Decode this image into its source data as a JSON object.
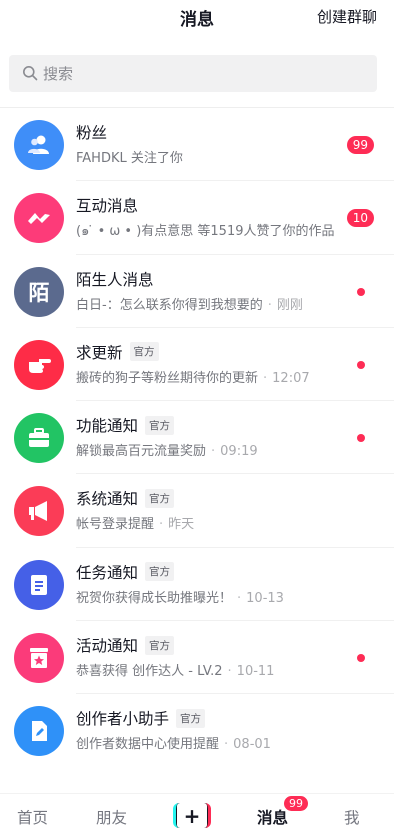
{
  "header": {
    "title": "消息",
    "action_label": "创建群聊"
  },
  "search": {
    "placeholder": "搜索"
  },
  "messages": [
    {
      "title": "粉丝",
      "subtitle": "FAHDKL 关注了你",
      "badge": "99",
      "avatar_color": "#3f8ef8",
      "icon": "users-icon"
    },
    {
      "title": "互动消息",
      "subtitle": "(๑ ̇ • ω • )有点意思 等1519人赞了你的作品",
      "badge": "10",
      "avatar_color": "#fd3b79",
      "icon": "wave-icon"
    },
    {
      "title": "陌生人消息",
      "subtitle": "白日-：怎么联系你得到我想要的",
      "time": "刚刚",
      "dot": true,
      "avatar_color": "#5b6a8e",
      "avatar_char": "陌"
    },
    {
      "title": "求更新",
      "tag": "官方",
      "subtitle": "搬砖的狗子等粉丝期待你的更新",
      "time": "12:07",
      "dot": true,
      "avatar_color": "#fe2c47",
      "icon": "pointing-hand-icon"
    },
    {
      "title": "功能通知",
      "tag": "官方",
      "subtitle": "解锁最高百元流量奖励",
      "time": "09:19",
      "dot": true,
      "avatar_color": "#22c464",
      "icon": "briefcase-icon"
    },
    {
      "title": "系统通知",
      "tag": "官方",
      "subtitle": "帐号登录提醒",
      "time": "昨天",
      "avatar_color": "#fb3c57",
      "icon": "megaphone-icon"
    },
    {
      "title": "任务通知",
      "tag": "官方",
      "subtitle": "祝贺你获得成长助推曝光！",
      "time": "10-13",
      "avatar_color": "#4560e7",
      "icon": "document-icon"
    },
    {
      "title": "活动通知",
      "tag": "官方",
      "subtitle": "恭喜获得 创作达人 - LV.2",
      "time": "10-11",
      "dot": true,
      "avatar_color": "#fb3b7a",
      "icon": "star-box-icon"
    },
    {
      "title": "创作者小助手",
      "tag": "官方",
      "subtitle": "创作者数据中心使用提醒",
      "time": "08-01",
      "avatar_color": "#2f91f8",
      "icon": "edit-file-icon"
    }
  ],
  "tabbar": {
    "home": "首页",
    "friends": "朋友",
    "plus": "+",
    "messages": "消息",
    "messages_badge": "99",
    "me": "我"
  }
}
